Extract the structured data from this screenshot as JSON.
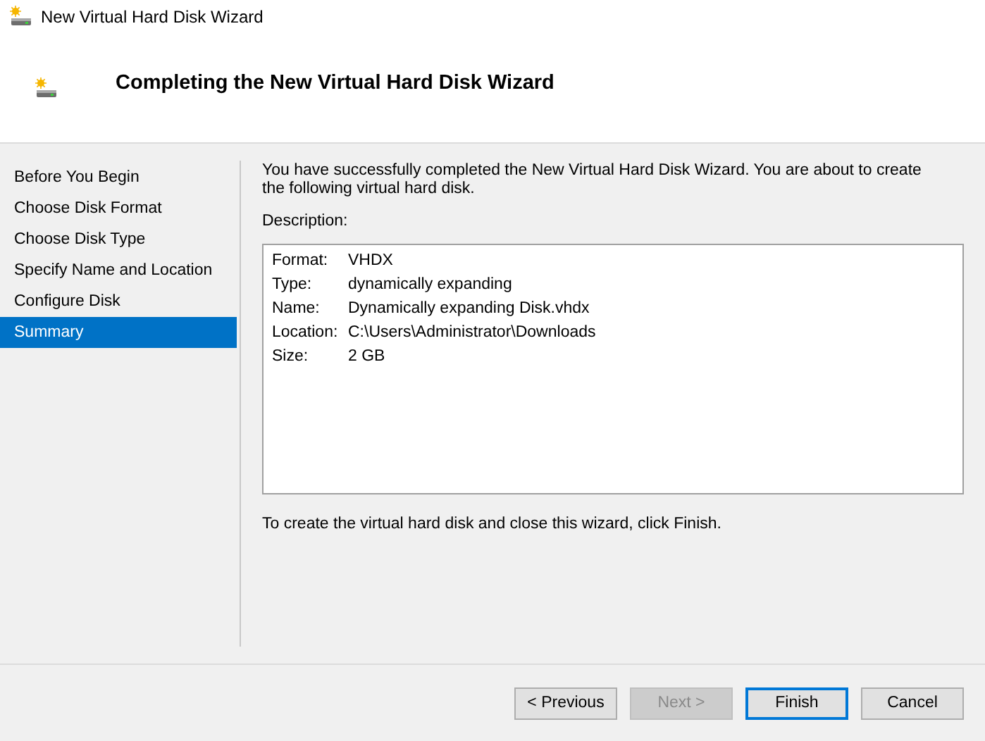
{
  "window": {
    "title": "New Virtual Hard Disk Wizard"
  },
  "header": {
    "title": "Completing the New Virtual Hard Disk Wizard"
  },
  "steps": [
    {
      "label": "Before You Begin",
      "selected": false
    },
    {
      "label": "Choose Disk Format",
      "selected": false
    },
    {
      "label": "Choose Disk Type",
      "selected": false
    },
    {
      "label": "Specify Name and Location",
      "selected": false
    },
    {
      "label": "Configure Disk",
      "selected": false
    },
    {
      "label": "Summary",
      "selected": true
    }
  ],
  "intro": "You have successfully completed the New Virtual Hard Disk Wizard. You are about to create the following virtual hard disk.",
  "description_label": "Description:",
  "summary": [
    {
      "label": "Format:",
      "value": "VHDX"
    },
    {
      "label": "Type:",
      "value": "dynamically expanding"
    },
    {
      "label": "Name:",
      "value": "Dynamically expanding Disk.vhdx"
    },
    {
      "label": "Location:",
      "value": "C:\\Users\\Administrator\\Downloads"
    },
    {
      "label": "Size:",
      "value": "2 GB"
    }
  ],
  "instruction": "To create the virtual hard disk and close this wizard, click Finish.",
  "buttons": [
    {
      "label": "< Previous",
      "disabled": false,
      "focused": false
    },
    {
      "label": "Next >",
      "disabled": true,
      "focused": false
    },
    {
      "label": "Finish",
      "disabled": false,
      "focused": true
    },
    {
      "label": "Cancel",
      "disabled": false,
      "focused": false
    }
  ]
}
